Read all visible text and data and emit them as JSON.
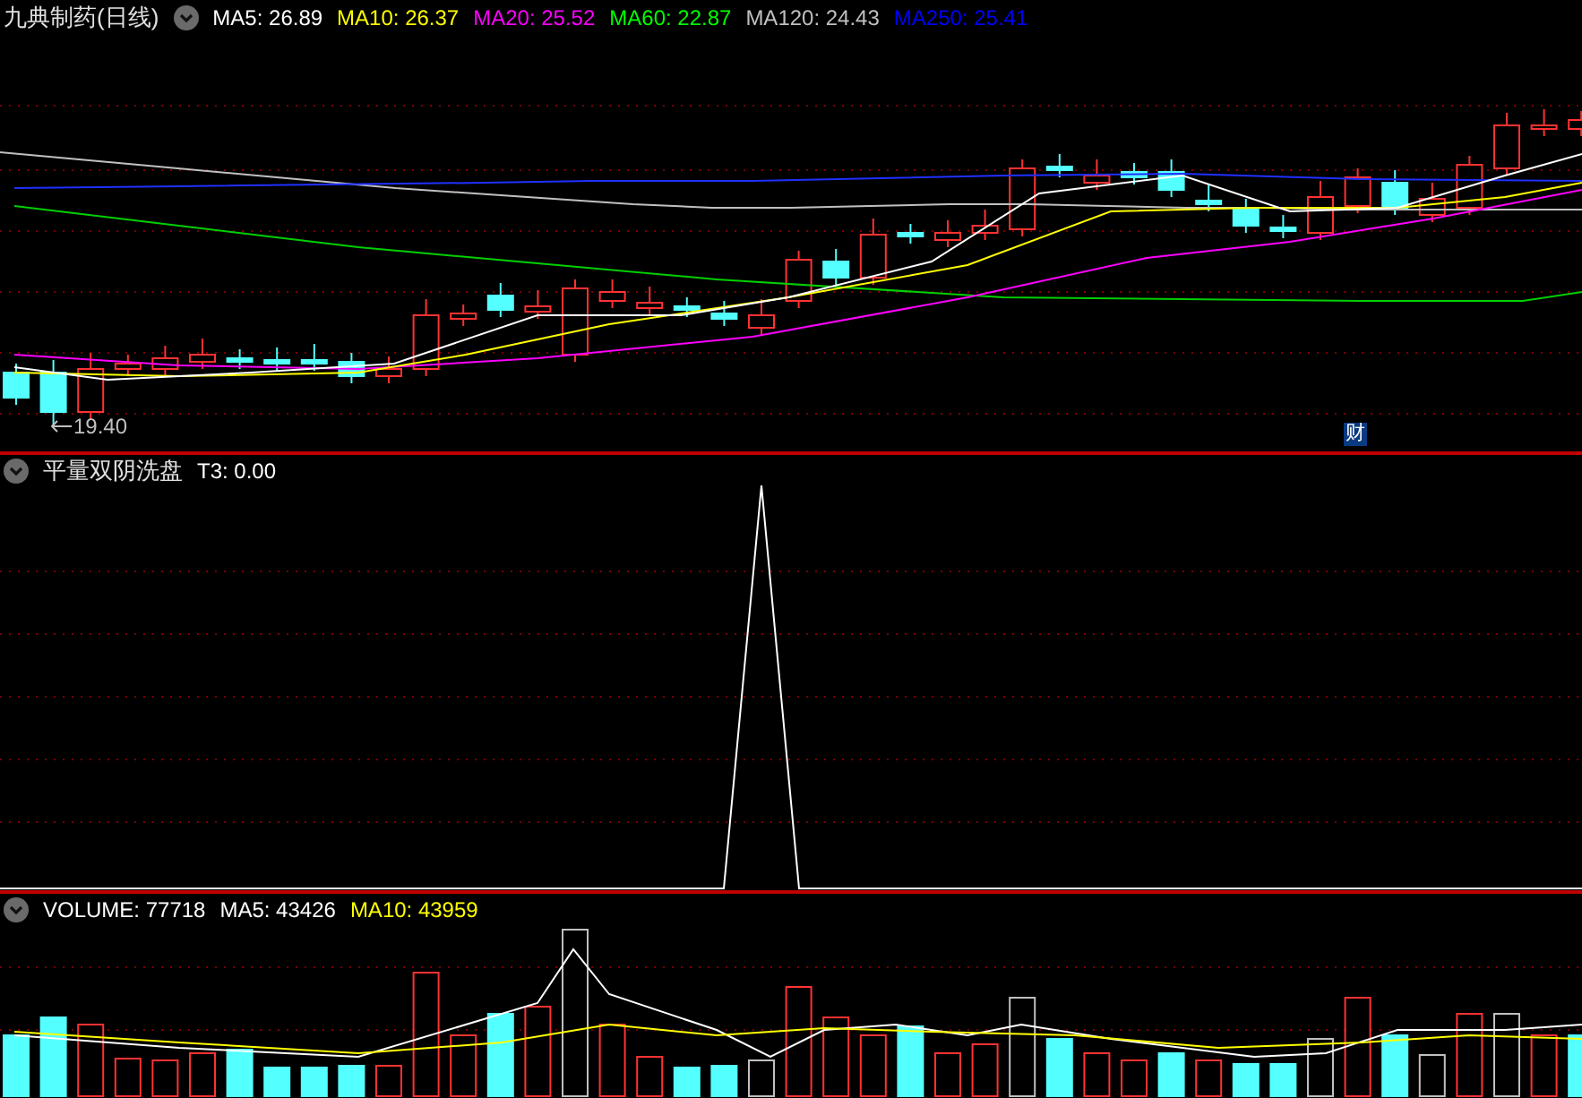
{
  "main_panel": {
    "title": "九典制药(日线)",
    "legend": [
      {
        "label": "MA5: 26.89",
        "color": "#ffffff"
      },
      {
        "label": "MA10: 26.37",
        "color": "#ffff00"
      },
      {
        "label": "MA20: 25.52",
        "color": "#ff00ff"
      },
      {
        "label": "MA60: 22.87",
        "color": "#00ff00"
      },
      {
        "label": "MA120: 24.43",
        "color": "#c0c0c0"
      },
      {
        "label": "MA250: 25.41",
        "color": "#0000ff"
      }
    ],
    "low_marker": "19.40",
    "badge": "财"
  },
  "indicator_panel": {
    "title": "平量双阴洗盘",
    "legend": [
      {
        "label": "T3: 0.00",
        "color": "#ffffff"
      }
    ]
  },
  "volume_panel": {
    "legend": [
      {
        "label": "VOLUME: 77718",
        "color": "#ffffff"
      },
      {
        "label": "MA5: 43426",
        "color": "#ffffff"
      },
      {
        "label": "MA10: 43959",
        "color": "#ffff00"
      }
    ]
  }
}
